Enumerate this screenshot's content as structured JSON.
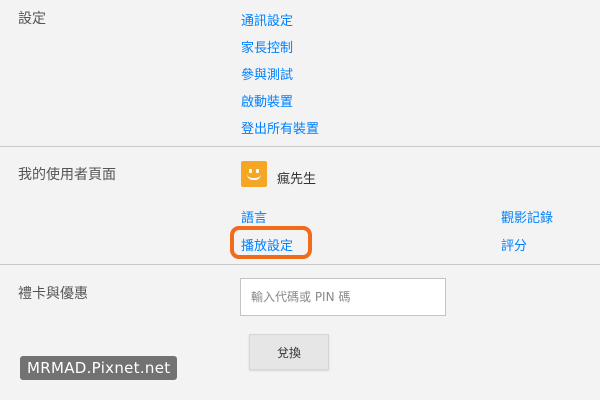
{
  "settings": {
    "label": "設定",
    "links": [
      "通訊設定",
      "家長控制",
      "參與測試",
      "啟動裝置",
      "登出所有裝置"
    ]
  },
  "profile": {
    "label": "我的使用者頁面",
    "name": "瘋先生",
    "links_left": [
      "語言",
      "播放設定"
    ],
    "links_right": [
      "觀影記錄",
      "評分"
    ],
    "highlight_color": "#f26a1b",
    "avatar_color": "#f5a623"
  },
  "gift": {
    "label": "禮卡與優惠",
    "input_placeholder": "輸入代碼或 PIN 碼",
    "redeem_label": "兌換"
  },
  "watermark": "MRMAD.Pixnet.net",
  "colors": {
    "link": "#0080ff",
    "background": "#f3f3f3"
  }
}
